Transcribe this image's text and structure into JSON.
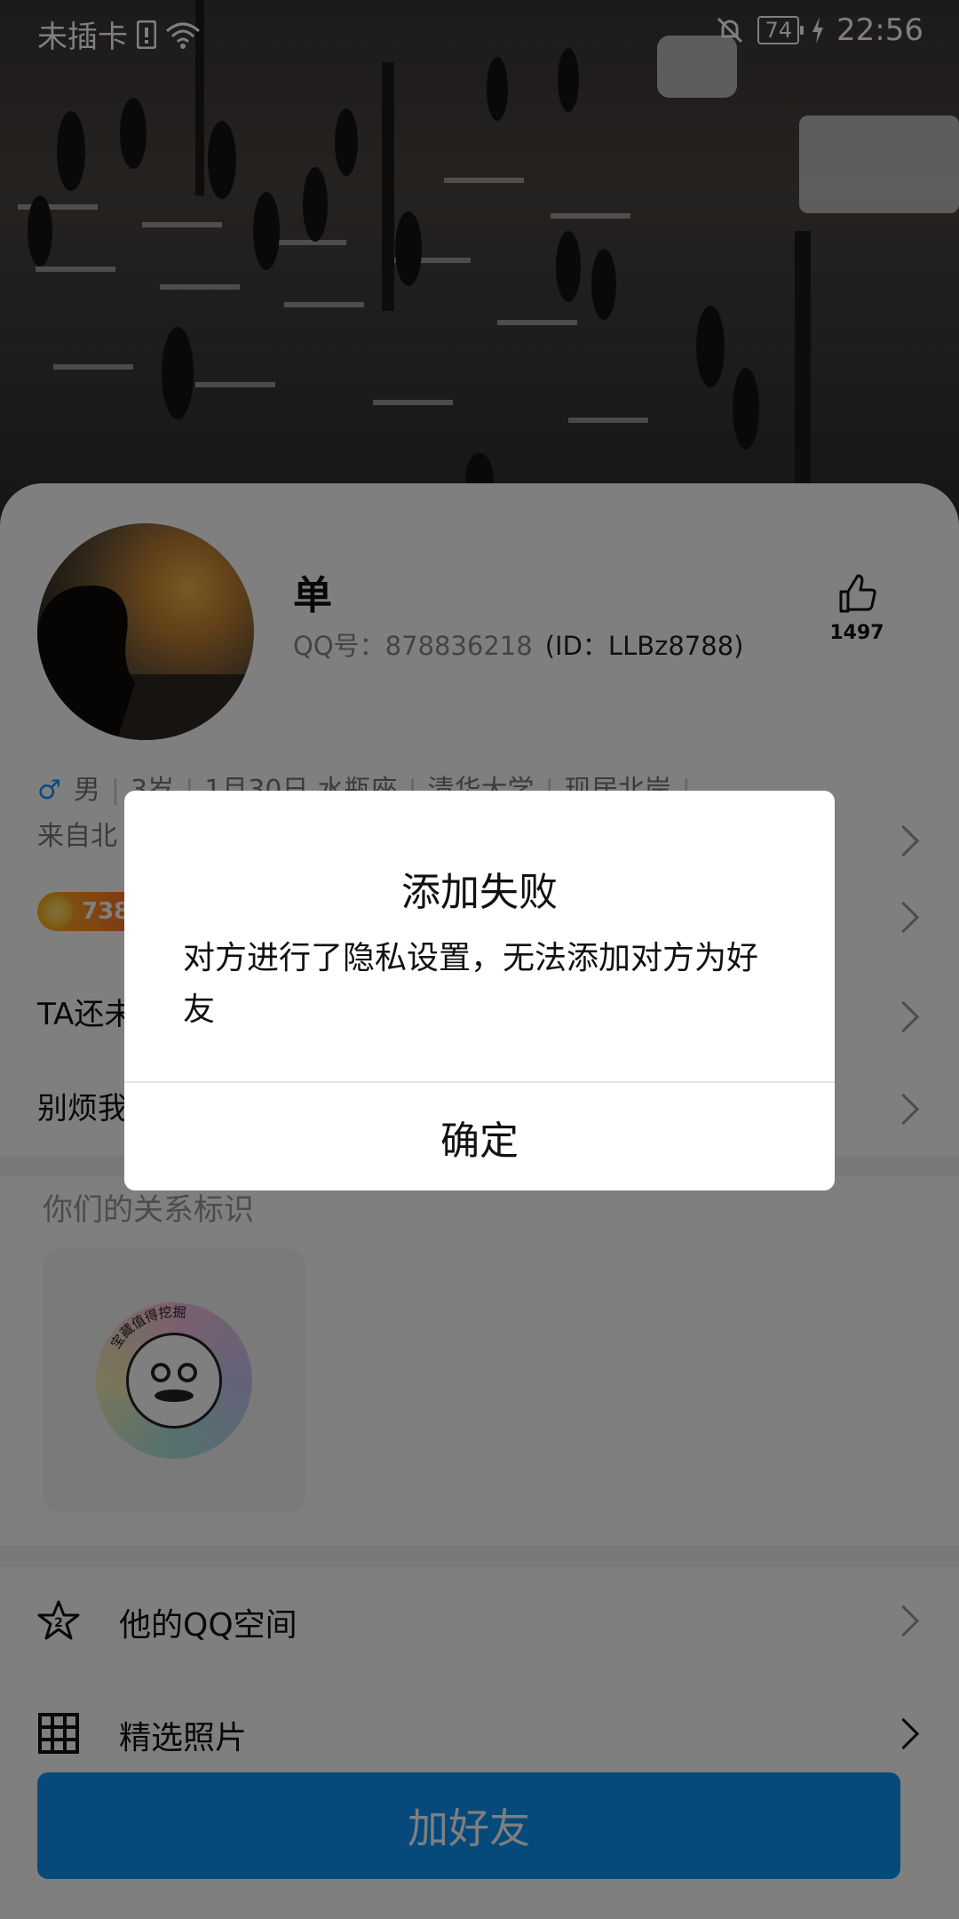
{
  "status_bar": {
    "carrier": "未插卡",
    "battery": "74",
    "time": "22:56"
  },
  "profile": {
    "nickname": "单",
    "qq_label": "QQ号：878836218",
    "id_label": "(ID：LLBz8788)",
    "like_count": "1497",
    "gender_symbol": "♂",
    "gender": "男",
    "age": "3岁",
    "birthday": "1月30日",
    "zodiac": "水瓶座",
    "school": "清华大学",
    "residence": "现居北岸",
    "from": "来自北",
    "coin_value": "738",
    "row_ta": "TA还未",
    "row_block": "别烦我"
  },
  "relation": {
    "title": "你们的关系标识",
    "badge_text": "宝藏值得挖掘"
  },
  "menu": {
    "qzone": "他的QQ空间",
    "photos": "精选照片"
  },
  "add_friend_button": "加好友",
  "dialog": {
    "title": "添加失败",
    "message": "对方进行了隐私设置，无法添加对方为好友",
    "confirm": "确定"
  }
}
